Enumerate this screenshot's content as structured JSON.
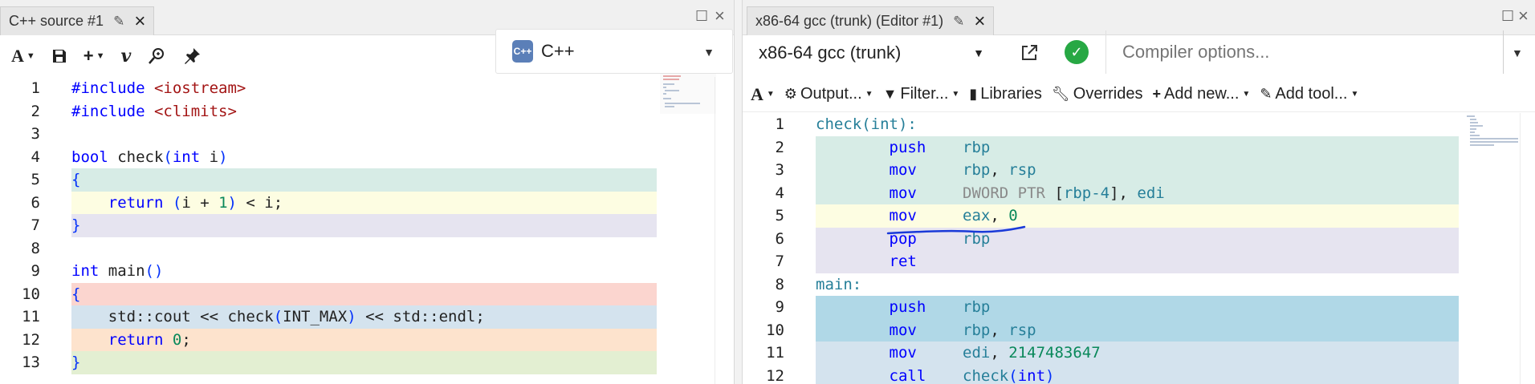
{
  "left": {
    "tab_title": "C++ source #1",
    "language": "C++",
    "cpp_logo_text": "C++",
    "toolbar_icons": [
      "font-size-icon",
      "save-icon",
      "add-icon",
      "vim-icon",
      "search-icon",
      "pin-icon"
    ],
    "lines": [
      {
        "n": "1",
        "hl": "",
        "tokens": [
          {
            "c": "inc",
            "t": "#include "
          },
          {
            "c": "str",
            "t": "<iostream>"
          }
        ]
      },
      {
        "n": "2",
        "hl": "",
        "tokens": [
          {
            "c": "inc",
            "t": "#include "
          },
          {
            "c": "str",
            "t": "<climits>"
          }
        ]
      },
      {
        "n": "3",
        "hl": "",
        "tokens": []
      },
      {
        "n": "4",
        "hl": "",
        "tokens": [
          {
            "c": "ty",
            "t": "bool"
          },
          {
            "c": "fn",
            "t": " check"
          },
          {
            "c": "paren",
            "t": "("
          },
          {
            "c": "ty",
            "t": "int"
          },
          {
            "c": "fn",
            "t": " i"
          },
          {
            "c": "paren",
            "t": ")"
          }
        ]
      },
      {
        "n": "5",
        "hl": "#d7ece6",
        "tokens": [
          {
            "c": "paren",
            "t": "{"
          }
        ]
      },
      {
        "n": "6",
        "hl": "#fdfde2",
        "tokens": [
          {
            "c": "fn",
            "t": "    "
          },
          {
            "c": "kw",
            "t": "return"
          },
          {
            "c": "fn",
            "t": " "
          },
          {
            "c": "paren",
            "t": "("
          },
          {
            "c": "fn",
            "t": "i + "
          },
          {
            "c": "num-lit",
            "t": "1"
          },
          {
            "c": "paren",
            "t": ")"
          },
          {
            "c": "fn",
            "t": " < i;"
          }
        ]
      },
      {
        "n": "7",
        "hl": "#e6e4f0",
        "tokens": [
          {
            "c": "paren",
            "t": "}"
          }
        ]
      },
      {
        "n": "8",
        "hl": "",
        "tokens": []
      },
      {
        "n": "9",
        "hl": "",
        "tokens": [
          {
            "c": "ty",
            "t": "int"
          },
          {
            "c": "fn",
            "t": " main"
          },
          {
            "c": "paren",
            "t": "()"
          }
        ]
      },
      {
        "n": "10",
        "hl": "#fbd5cf",
        "tokens": [
          {
            "c": "paren",
            "t": "{"
          }
        ]
      },
      {
        "n": "11",
        "hl": "#d4e3ee",
        "tokens": [
          {
            "c": "fn",
            "t": "    std::cout << check"
          },
          {
            "c": "paren",
            "t": "("
          },
          {
            "c": "fn",
            "t": "INT_MAX"
          },
          {
            "c": "paren",
            "t": ")"
          },
          {
            "c": "fn",
            "t": " << std::endl;"
          }
        ]
      },
      {
        "n": "12",
        "hl": "#fde3cd",
        "tokens": [
          {
            "c": "fn",
            "t": "    "
          },
          {
            "c": "kw",
            "t": "return"
          },
          {
            "c": "fn",
            "t": " "
          },
          {
            "c": "num-lit",
            "t": "0"
          },
          {
            "c": "fn",
            "t": ";"
          }
        ]
      },
      {
        "n": "13",
        "hl": "#e3efd2",
        "tokens": [
          {
            "c": "paren",
            "t": "}"
          }
        ]
      }
    ]
  },
  "right": {
    "tab_title": "x86-64 gcc (trunk) (Editor #1)",
    "compiler": "x86-64 gcc (trunk)",
    "options_placeholder": "Compiler options...",
    "output_toolbar": {
      "output": "Output...",
      "filter": "Filter...",
      "libraries": "Libraries",
      "overrides": "Overrides",
      "add_new": "Add new...",
      "add_tool": "Add tool..."
    },
    "lines": [
      {
        "n": "1",
        "hl": "",
        "tokens": [
          {
            "c": "lbl",
            "t": "check(int):"
          }
        ]
      },
      {
        "n": "2",
        "hl": "#d7ece6",
        "tokens": [
          {
            "c": "fn",
            "t": "        "
          },
          {
            "c": "mn",
            "t": "push"
          },
          {
            "c": "fn",
            "t": "    "
          },
          {
            "c": "reg",
            "t": "rbp"
          }
        ]
      },
      {
        "n": "3",
        "hl": "#d7ece6",
        "tokens": [
          {
            "c": "fn",
            "t": "        "
          },
          {
            "c": "mn",
            "t": "mov"
          },
          {
            "c": "fn",
            "t": "     "
          },
          {
            "c": "reg",
            "t": "rbp"
          },
          {
            "c": "fn",
            "t": ", "
          },
          {
            "c": "reg",
            "t": "rsp"
          }
        ]
      },
      {
        "n": "4",
        "hl": "#d7ece6",
        "tokens": [
          {
            "c": "fn",
            "t": "        "
          },
          {
            "c": "mn",
            "t": "mov"
          },
          {
            "c": "fn",
            "t": "     "
          },
          {
            "c": "dw",
            "t": "DWORD PTR "
          },
          {
            "c": "fn",
            "t": "["
          },
          {
            "c": "reg",
            "t": "rbp-4"
          },
          {
            "c": "fn",
            "t": "], "
          },
          {
            "c": "reg",
            "t": "edi"
          }
        ]
      },
      {
        "n": "5",
        "hl": "#fdfde2",
        "tokens": [
          {
            "c": "fn",
            "t": "        "
          },
          {
            "c": "mn",
            "t": "mov"
          },
          {
            "c": "fn",
            "t": "     "
          },
          {
            "c": "reg",
            "t": "eax"
          },
          {
            "c": "fn",
            "t": ", "
          },
          {
            "c": "num-lit",
            "t": "0"
          }
        ]
      },
      {
        "n": "6",
        "hl": "#e6e4f0",
        "tokens": [
          {
            "c": "fn",
            "t": "        "
          },
          {
            "c": "mn",
            "t": "pop"
          },
          {
            "c": "fn",
            "t": "     "
          },
          {
            "c": "reg",
            "t": "rbp"
          }
        ]
      },
      {
        "n": "7",
        "hl": "#e6e4f0",
        "tokens": [
          {
            "c": "fn",
            "t": "        "
          },
          {
            "c": "mn",
            "t": "ret"
          }
        ]
      },
      {
        "n": "8",
        "hl": "",
        "tokens": [
          {
            "c": "lbl",
            "t": "main:"
          }
        ]
      },
      {
        "n": "9",
        "hl": "#b0d8e7",
        "tokens": [
          {
            "c": "fn",
            "t": "        "
          },
          {
            "c": "mn",
            "t": "push"
          },
          {
            "c": "fn",
            "t": "    "
          },
          {
            "c": "reg",
            "t": "rbp"
          }
        ]
      },
      {
        "n": "10",
        "hl": "#b0d8e7",
        "tokens": [
          {
            "c": "fn",
            "t": "        "
          },
          {
            "c": "mn",
            "t": "mov"
          },
          {
            "c": "fn",
            "t": "     "
          },
          {
            "c": "reg",
            "t": "rbp"
          },
          {
            "c": "fn",
            "t": ", "
          },
          {
            "c": "reg",
            "t": "rsp"
          }
        ]
      },
      {
        "n": "11",
        "hl": "#d4e3ee",
        "tokens": [
          {
            "c": "fn",
            "t": "        "
          },
          {
            "c": "mn",
            "t": "mov"
          },
          {
            "c": "fn",
            "t": "     "
          },
          {
            "c": "reg",
            "t": "edi"
          },
          {
            "c": "fn",
            "t": ", "
          },
          {
            "c": "num-lit",
            "t": "2147483647"
          }
        ]
      },
      {
        "n": "12",
        "hl": "#d4e3ee",
        "tokens": [
          {
            "c": "fn",
            "t": "        "
          },
          {
            "c": "mn",
            "t": "call"
          },
          {
            "c": "fn",
            "t": "    "
          },
          {
            "c": "reg",
            "t": "check"
          },
          {
            "c": "paren",
            "t": "("
          },
          {
            "c": "ty",
            "t": "int"
          },
          {
            "c": "paren",
            "t": ")"
          }
        ]
      }
    ]
  },
  "colors": {
    "success_green": "#27a844",
    "annotation_blue": "#1a3ad8"
  }
}
